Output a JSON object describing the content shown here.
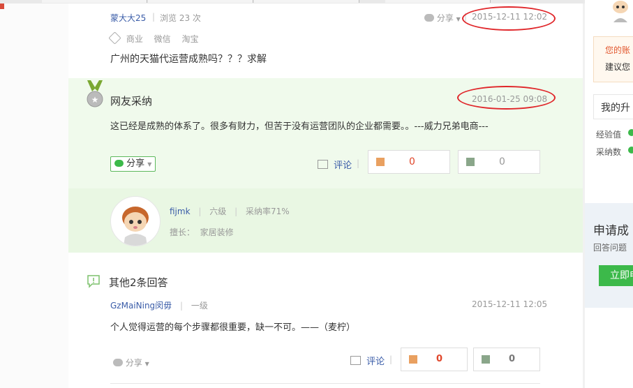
{
  "question": {
    "author": "蒙大大25",
    "views": "浏览 23 次",
    "share": "分享",
    "datetime": "2015-12-11 12:02",
    "tags": [
      "商业",
      "微信",
      "淘宝"
    ],
    "title": "广州的天猫代运营成熟吗？？？求解"
  },
  "accepted": {
    "label": "网友采纳",
    "datetime": "2016-01-25 09:08",
    "text": "这已经是成熟的体系了。很多有财力，但苦于没有运营团队的企业都需要。。---威力兄弟电商---",
    "share": "分享",
    "comment": "评论",
    "up": "0",
    "down": "0",
    "user": {
      "name": "fijmk",
      "level": "六级",
      "rate": "采纳率71%",
      "expertise": "擅长：  家居装修"
    }
  },
  "others": {
    "heading": "其他2条回答",
    "answers": [
      {
        "user": "GzMaiNing闵毋",
        "level": "一级",
        "datetime": "2015-12-11 12:05",
        "text": "个人觉得运营的每个步骤都很重要，缺一不可。——（麦柠）",
        "share": "分享",
        "comment": "评论",
        "up": "0",
        "down": "0"
      }
    ]
  },
  "sidebar": {
    "notice_line1": "您的账",
    "notice_line2": "建议您",
    "upgrade_title": "我的升",
    "exp_label": "经验值",
    "accept_label": "采纳数",
    "apply_title": "申请成",
    "apply_sub": "回答问题",
    "apply_button": "立即申"
  },
  "colors": {
    "accent_blue": "#3a5ca8",
    "green_bg": "#f0faec",
    "vote_up_red": "#e0462a",
    "annotation_red": "#e0262a",
    "apply_green": "#3cb94a"
  }
}
